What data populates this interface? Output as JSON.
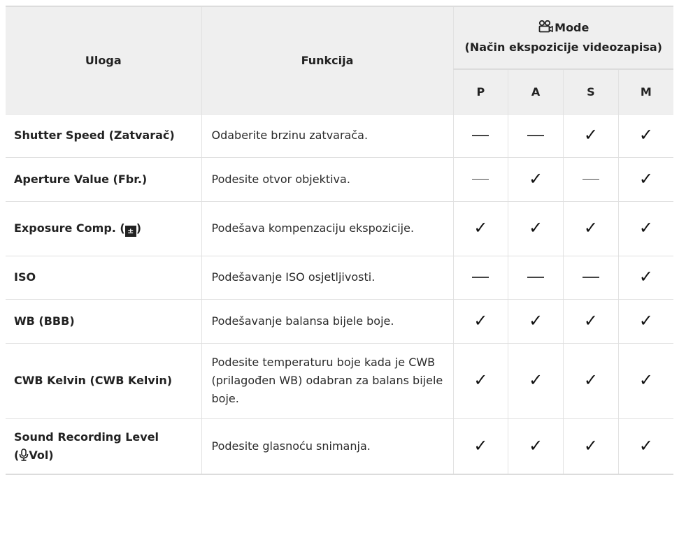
{
  "header": {
    "role": "Uloga",
    "function": "Funkcija",
    "mode_title": "Mode",
    "mode_subtitle": "(Način ekspozicije videozapisa)",
    "modes": [
      "P",
      "A",
      "S",
      "M"
    ]
  },
  "rows": [
    {
      "role": "Shutter Speed (Zatvarač)",
      "function": "Odaberite brzinu zatvarača.",
      "marks": [
        "—",
        "—",
        "✓",
        "✓"
      ]
    },
    {
      "role": "Aperture Value (Fbr.)",
      "function": "Podesite otvor objektiva.",
      "marks": [
        "—",
        "✓",
        "—",
        "✓"
      ]
    },
    {
      "role_prefix": "Exposure Comp. (",
      "role_suffix": ")",
      "role_icon": "exposure-comp-icon",
      "function": "Podešava kompenzaciju ekspozicije.",
      "marks": [
        "✓",
        "✓",
        "✓",
        "✓"
      ]
    },
    {
      "role": "ISO",
      "function": "Podešavanje ISO osjetljivosti.",
      "marks": [
        "—",
        "—",
        "—",
        "✓"
      ]
    },
    {
      "role": "WB (BBB)",
      "function": "Podešavanje balansa bijele boje.",
      "marks": [
        "✓",
        "✓",
        "✓",
        "✓"
      ]
    },
    {
      "role": "CWB Kelvin (CWB Kelvin)",
      "function": "Podesite temperaturu boje kada je CWB (prilagođen WB) odabran za balans bijele boje.",
      "marks": [
        "✓",
        "✓",
        "✓",
        "✓"
      ]
    },
    {
      "role_line1": "Sound Recording Level",
      "role_line2_prefix": "(",
      "role_line2_suffix": "Vol)",
      "role_icon": "microphone-icon",
      "function": "Podesite glasnoću snimanja.",
      "marks": [
        "✓",
        "✓",
        "✓",
        "✓"
      ]
    }
  ],
  "icons": {
    "mode": "movie-camera-icon"
  }
}
